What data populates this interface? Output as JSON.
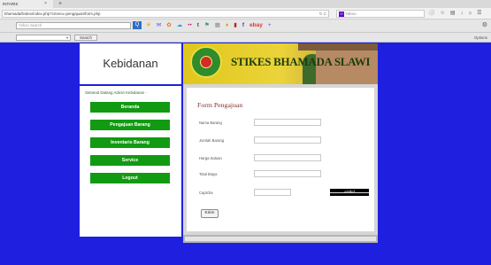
{
  "browser": {
    "tab_title": "INTARIS",
    "tab_close": "×",
    "new_tab": "+",
    "url": "bhamada/lindex/index.php?cmenu=pengajuan/form.php",
    "reload_glyph": "↻ C",
    "search_placeholder": "Yahoo",
    "search_engine_glyph": "Y!"
  },
  "toolbar": {
    "search_placeholder": "Yahoo Search",
    "go_glyph": "Q",
    "search_button": "Search",
    "dropdown_glyph": "▾",
    "options_label": "Options"
  },
  "page": {
    "brand": "Kebidanan",
    "banner_title": "STIKES BHAMADA SLAWI",
    "welcome_text": "Selamat Datang Admin Kebidanan -",
    "menu": [
      {
        "label": "Beranda"
      },
      {
        "label": "Pengajuan Barang"
      },
      {
        "label": "Inventaris Barang"
      },
      {
        "label": "Service"
      },
      {
        "label": "Logout"
      }
    ],
    "form": {
      "title": "Form Pengajuan",
      "fields": [
        {
          "label": "Nama Barang",
          "value": ""
        },
        {
          "label": "Jumlah Barang",
          "value": ""
        },
        {
          "label": "Harga Satuan",
          "value": ""
        },
        {
          "label": "Total Biaya",
          "value": ""
        }
      ],
      "captcha_label": "Captcha",
      "captcha_value": "",
      "captcha_image_text": "eStkd",
      "submit_label": "Kirim"
    }
  },
  "colors": {
    "page_background": "#1f1fe0",
    "menu_button": "#129a12",
    "form_title": "#803030"
  }
}
